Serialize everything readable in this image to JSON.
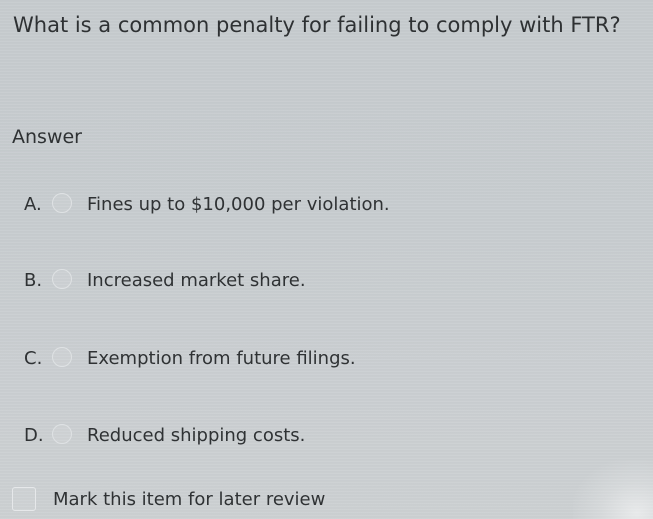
{
  "question": {
    "text": "What is a common penalty for failing to comply with FTR?"
  },
  "answer": {
    "heading": "Answer",
    "options": [
      {
        "letter": "A.",
        "text": "Fines up to $10,000 per violation."
      },
      {
        "letter": "B.",
        "text": "Increased market share."
      },
      {
        "letter": "C.",
        "text": "Exemption from future filings."
      },
      {
        "letter": "D.",
        "text": "Reduced shipping costs."
      }
    ]
  },
  "review": {
    "label": "Mark this item for later review",
    "checked": false
  }
}
